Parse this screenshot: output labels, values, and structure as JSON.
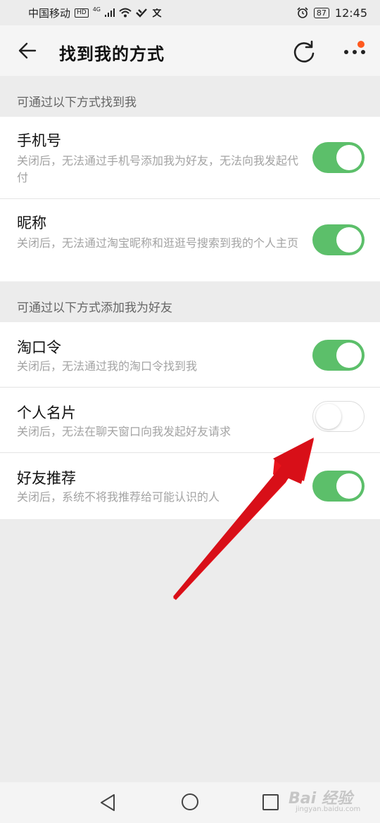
{
  "status_bar": {
    "carrier": "中国移动",
    "hd_badge": "HD",
    "network": "4G",
    "battery": "87",
    "time": "12:45"
  },
  "header": {
    "title": "找到我的方式"
  },
  "sections": [
    {
      "header": "可通过以下方式找到我",
      "items": [
        {
          "title": "手机号",
          "desc": "关闭后，无法通过手机号添加我为好友，无法向我发起代付",
          "enabled": true
        },
        {
          "title": "昵称",
          "desc": "关闭后，无法通过淘宝昵称和逛逛号搜索到我的个人主页",
          "enabled": true
        }
      ]
    },
    {
      "header": "可通过以下方式添加我为好友",
      "items": [
        {
          "title": "淘口令",
          "desc": "关闭后，无法通过我的淘口令找到我",
          "enabled": true
        },
        {
          "title": "个人名片",
          "desc": "关闭后，无法在聊天窗口向我发起好友请求",
          "enabled": false
        },
        {
          "title": "好友推荐",
          "desc": "关闭后，系统不将我推荐给可能认识的人",
          "enabled": true
        }
      ]
    }
  ],
  "watermark": {
    "brand": "Bai 经验",
    "url": "jingyan.baidu.com"
  },
  "colors": {
    "toggle_on": "#5cbf6a",
    "notify_dot": "#ff5a1f",
    "annotation_arrow": "#e8141c"
  }
}
